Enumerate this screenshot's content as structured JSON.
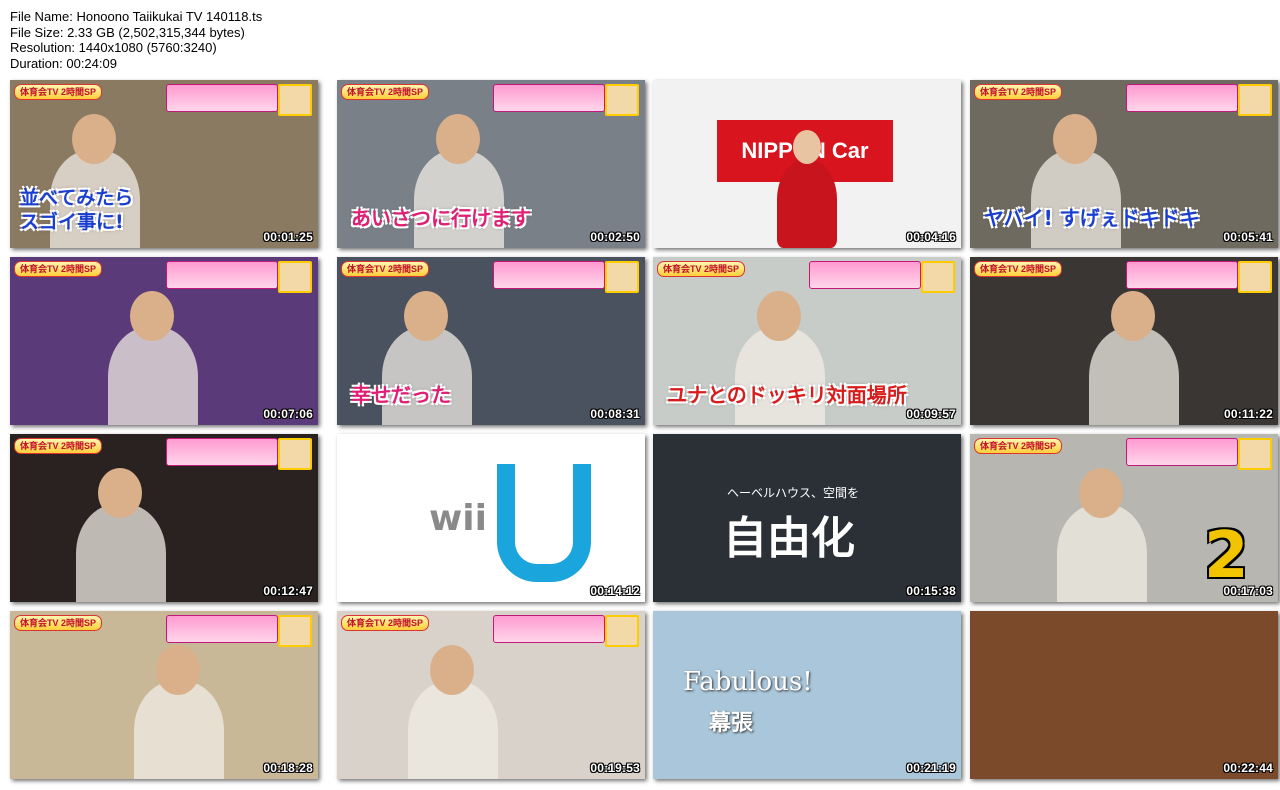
{
  "file_info": {
    "file_name": "File Name: Honoono Taiikukai TV 140118.ts",
    "file_size": "File Size: 2.33 GB (2,502,315,344 bytes)",
    "resolution": "Resolution: 1440x1080 (5760:3240)",
    "duration": "Duration: 00:24:09"
  },
  "thumbnails": [
    {
      "timestamp": "00:01:25",
      "caption": "並べてみたら\nスゴイ事に!",
      "caption_color": "#1a3fd0",
      "bg": "#8a7a62",
      "banner": "体育会TV 2時間SP"
    },
    {
      "timestamp": "00:02:50",
      "caption": "あいさつに行けます",
      "caption_color": "#e01e74",
      "bg": "#7a8088",
      "banner": "体育会TV 2時間SP"
    },
    {
      "timestamp": "00:04:16",
      "caption": "",
      "caption_color": "#000000",
      "bg": "#f2f2f2",
      "logo_text": "NIPPON Car"
    },
    {
      "timestamp": "00:05:41",
      "caption": "ヤバイ! すげぇドキドキ",
      "caption_color": "#1a3fd0",
      "bg": "#6f6a60",
      "banner": "体育会TV 2時間SP"
    },
    {
      "timestamp": "00:07:06",
      "caption": "",
      "caption_color": "#000000",
      "bg": "#5a3a78",
      "banner": "体育会TV 2時間SP"
    },
    {
      "timestamp": "00:08:31",
      "caption": "幸せだった",
      "caption_color": "#e01e74",
      "bg": "#4a5260",
      "banner": "体育会TV 2時間SP"
    },
    {
      "timestamp": "00:09:57",
      "caption": "ユナとのドッキリ対面場所",
      "caption_color": "#d81c1c",
      "bg": "#c8ccc8",
      "banner": "体育会TV 2時間SP"
    },
    {
      "timestamp": "00:11:22",
      "caption": "",
      "caption_color": "#000000",
      "bg": "#3a3634",
      "banner": "体育会TV 2時間SP"
    },
    {
      "timestamp": "00:12:47",
      "caption": "",
      "caption_color": "#000000",
      "bg": "#2a2220",
      "banner": "体育会TV 2時間SP"
    },
    {
      "timestamp": "00:14:12",
      "caption": "",
      "caption_color": "#000000",
      "bg": "#ffffff",
      "logo_text": "wii"
    },
    {
      "timestamp": "00:15:38",
      "caption": "自由化",
      "caption_color": "#ffffff",
      "bg": "#2a3036",
      "subcaption": "ヘーベルハウス、空間を"
    },
    {
      "timestamp": "00:17:03",
      "caption": "2",
      "caption_color": "#f2c400",
      "bg": "#b8b6b0",
      "banner": "体育会TV 2時間SP"
    },
    {
      "timestamp": "00:18:28",
      "caption": "",
      "caption_color": "#000000",
      "bg": "#c9b898",
      "banner": "体育会TV 2時間SP"
    },
    {
      "timestamp": "00:19:53",
      "caption": "",
      "caption_color": "#000000",
      "bg": "#d8d2ca",
      "banner": "体育会TV 2時間SP"
    },
    {
      "timestamp": "00:21:19",
      "caption": "Fabulous!",
      "caption_color": "#ffffff",
      "bg": "#a9c6da",
      "subcaption": "幕張"
    },
    {
      "timestamp": "00:22:44",
      "caption": "",
      "caption_color": "#000000",
      "bg": "#7a4a2a"
    }
  ]
}
